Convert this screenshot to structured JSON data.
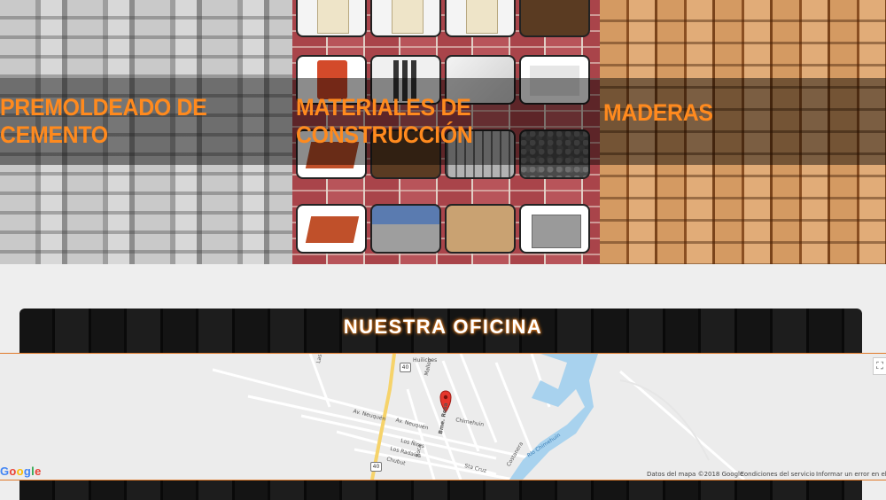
{
  "categories": [
    {
      "title_line1": "PREMOLDEADO DE",
      "title_line2": "CEMENTO"
    },
    {
      "title_line1": "MATERIALES DE",
      "title_line2": "CONSTRUCCIÓN"
    },
    {
      "title_line1": "MADERAS",
      "title_line2": ""
    }
  ],
  "office": {
    "title": "NUESTRA OFICINA"
  },
  "map": {
    "route_number": "40",
    "streets": {
      "huiliches": "Huiliches",
      "las_fuentes": "Las Fuentes",
      "malleo": "Malleo",
      "av_neuquen_1": "Av. Neuquén",
      "av_neuquen_2": "Av. Neuquén",
      "los_notros": "Los Ñires",
      "los_radales": "Los Radales",
      "chubut": "Chubut",
      "sta_cruz": "Sta Cruz",
      "chimehuin_st": "Chimehuin",
      "rio_chimehuin": "Río Chimehuin",
      "costanera": "Costanera",
      "roca": "Roca",
      "bmse_rosa": "Bme. Rosa"
    },
    "google": [
      "G",
      "o",
      "o",
      "g",
      "l",
      "e"
    ],
    "map_data": "Datos del mapa ©2018 Google",
    "terms": "Condiciones del servicio",
    "report": "Informar un error en el mapa",
    "fullscreen_symbol": "⛶",
    "colors": {
      "water": "#a8d2ee",
      "roads": "#ffffff",
      "highway": "#f6d36a",
      "pin": "#e5372d"
    }
  },
  "colors": {
    "accent": "#ff8a1e"
  }
}
